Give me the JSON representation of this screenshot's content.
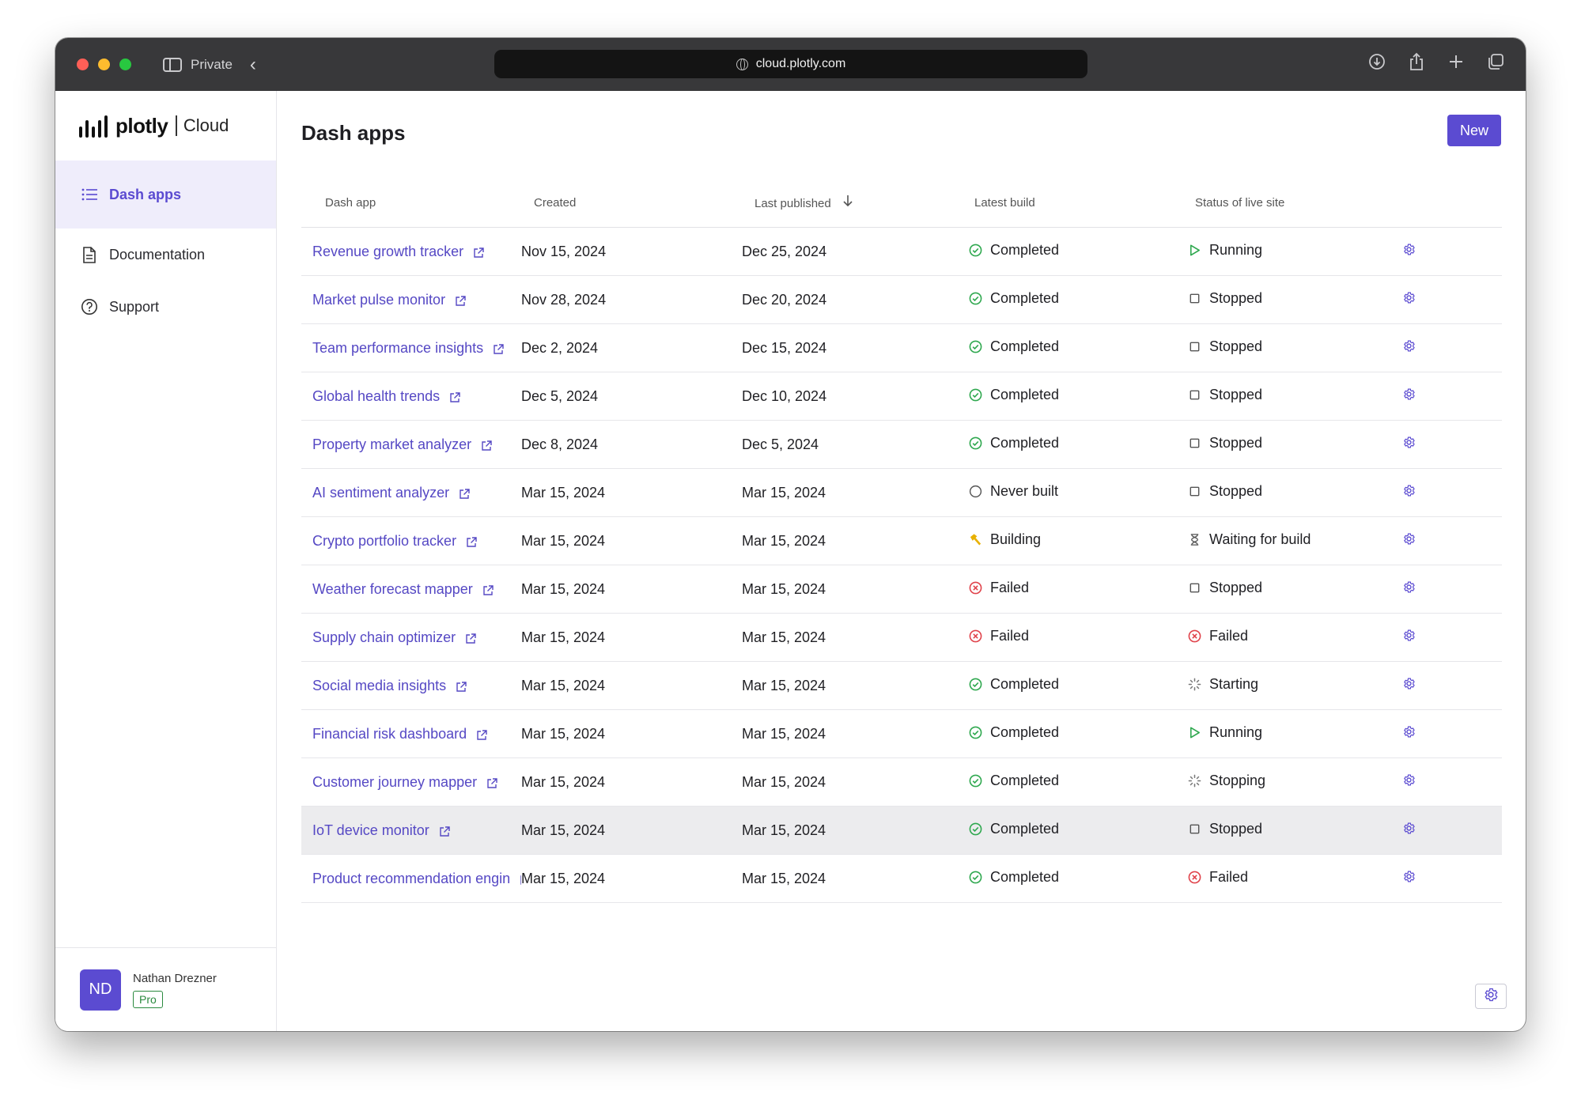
{
  "browser": {
    "private_label": "Private",
    "url": "cloud.plotly.com"
  },
  "brand": {
    "name": "plotly",
    "product": "Cloud"
  },
  "sidebar": {
    "items": [
      {
        "label": "Dash apps",
        "icon": "list-icon",
        "active": true
      },
      {
        "label": "Documentation",
        "icon": "document-icon",
        "active": false
      },
      {
        "label": "Support",
        "icon": "help-circle-icon",
        "active": false
      }
    ],
    "user": {
      "initials": "ND",
      "name": "Nathan Drezner",
      "plan": "Pro"
    }
  },
  "main": {
    "title": "Dash apps",
    "new_label": "New"
  },
  "table": {
    "headers": [
      "Dash app",
      "Created",
      "Last published",
      "Latest build",
      "Status of live site"
    ],
    "rows": [
      {
        "name": "Revenue growth tracker",
        "created": "Nov 15, 2024",
        "published": "Dec 25, 2024",
        "build": "Completed",
        "status": "Running"
      },
      {
        "name": "Market pulse monitor",
        "created": "Nov 28, 2024",
        "published": "Dec 20, 2024",
        "build": "Completed",
        "status": "Stopped"
      },
      {
        "name": "Team performance insights",
        "created": "Dec 2, 2024",
        "published": "Dec 15, 2024",
        "build": "Completed",
        "status": "Stopped"
      },
      {
        "name": "Global health trends",
        "created": "Dec 5, 2024",
        "published": "Dec 10, 2024",
        "build": "Completed",
        "status": "Stopped"
      },
      {
        "name": "Property market analyzer",
        "created": "Dec 8, 2024",
        "published": "Dec 5, 2024",
        "build": "Completed",
        "status": "Stopped"
      },
      {
        "name": "AI sentiment analyzer",
        "created": "Mar 15, 2024",
        "published": "Mar 15, 2024",
        "build": "Never built",
        "status": "Stopped"
      },
      {
        "name": "Crypto portfolio tracker",
        "created": "Mar 15, 2024",
        "published": "Mar 15, 2024",
        "build": "Building",
        "status": "Waiting for build"
      },
      {
        "name": "Weather forecast mapper",
        "created": "Mar 15, 2024",
        "published": "Mar 15, 2024",
        "build": "Failed",
        "status": "Stopped"
      },
      {
        "name": "Supply chain optimizer",
        "created": "Mar 15, 2024",
        "published": "Mar 15, 2024",
        "build": "Failed",
        "status": "Failed"
      },
      {
        "name": "Social media insights",
        "created": "Mar 15, 2024",
        "published": "Mar 15, 2024",
        "build": "Completed",
        "status": "Starting"
      },
      {
        "name": "Financial risk dashboard",
        "created": "Mar 15, 2024",
        "published": "Mar 15, 2024",
        "build": "Completed",
        "status": "Running"
      },
      {
        "name": "Customer journey mapper",
        "created": "Mar 15, 2024",
        "published": "Mar 15, 2024",
        "build": "Completed",
        "status": "Stopping"
      },
      {
        "name": "IoT device monitor",
        "created": "Mar 15, 2024",
        "published": "Mar 15, 2024",
        "build": "Completed",
        "status": "Stopped",
        "highlighted": true
      },
      {
        "name": "Product recommendation engin",
        "created": "Mar 15, 2024",
        "published": "Mar 15, 2024",
        "build": "Completed",
        "status": "Failed"
      }
    ]
  },
  "colors": {
    "accent": "#5b4bd1",
    "link": "#5548c4",
    "success": "#2fa84f",
    "error": "#e0434b",
    "warning": "#e8b100",
    "neutral": "#666666"
  }
}
